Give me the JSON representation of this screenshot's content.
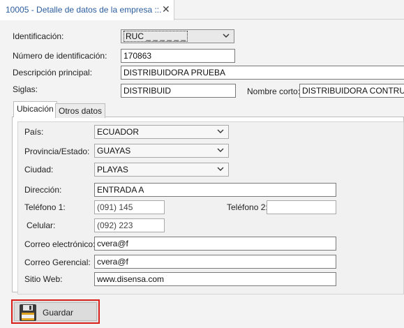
{
  "window": {
    "tab_title": "10005 - Detalle de datos de la empresa  ::.",
    "close_glyph": "✕"
  },
  "company": {
    "identificacion_label": "Identificación:",
    "identificacion_value": "RUC _ _ _ _ _ _",
    "numero_label": "Número de identificación:",
    "numero_value": "170863",
    "descripcion_label": "Descripción principal:",
    "descripcion_value": "DISTRIBUIDORA PRUEBA",
    "siglas_label": "Siglas:",
    "siglas_value": "DISTRIBUID",
    "nombre_corto_label": "Nombre corto:",
    "nombre_corto_value": "DISTRIBUIDORA CONTRU"
  },
  "tabs": [
    {
      "label": "Ubicación",
      "active": true
    },
    {
      "label": "Otros datos",
      "active": false
    }
  ],
  "ubicacion": {
    "pais_label": "País:",
    "pais_value": "ECUADOR",
    "provincia_label": "Provincia/Estado:",
    "provincia_value": "GUAYAS",
    "ciudad_label": "Ciudad:",
    "ciudad_value": "PLAYAS",
    "direccion_label": "Dirección:",
    "direccion_value": "ENTRADA A",
    "telefono1_label": "Teléfono 1:",
    "telefono1_value": "(091) 145",
    "telefono2_label": "Teléfono 2:",
    "telefono2_value": "",
    "celular_label": "Celular:",
    "celular_value": "(092) 223",
    "correo_label": "Correo electrónico:",
    "correo_value": "cvera@f",
    "correo_gerencial_label": "Correo Gerencial:",
    "correo_gerencial_value": "cvera@f",
    "sitio_web_label": "Sitio Web:",
    "sitio_web_value": "www.disensa.com"
  },
  "actions": {
    "save_label": "Guardar"
  },
  "colors": {
    "tab_title": "#2b5d9e",
    "save_highlight": "#d9201a",
    "field_border": "#7a7a7a"
  },
  "icons": {
    "save": "floppy-disk-icon",
    "dropdown": "chevron-down-icon",
    "close": "close-icon"
  }
}
